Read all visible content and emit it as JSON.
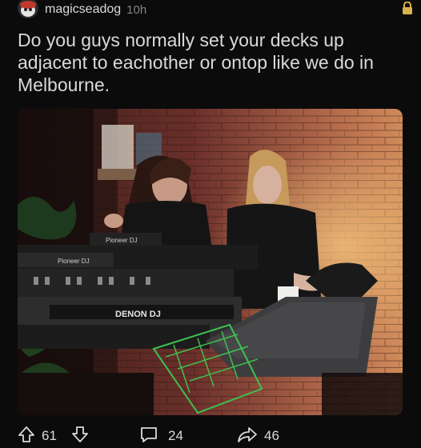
{
  "post": {
    "username": "magicseadog",
    "time": "10h",
    "title": "Do you guys normally set your decks up adjacent to eachother or ontop like we do in Melbourne.",
    "image_icon": "photo-of-two-djs-at-decks",
    "image_brand_labels": [
      "Pioneer DJ",
      "Pioneer DJ",
      "DENON DJ"
    ]
  },
  "actions": {
    "upvotes": "61",
    "comments": "24",
    "shares": "46"
  },
  "colors": {
    "background": "#0b0b0c",
    "text": "#d7dadc",
    "muted": "#818384",
    "lock": "#d8b24a"
  }
}
